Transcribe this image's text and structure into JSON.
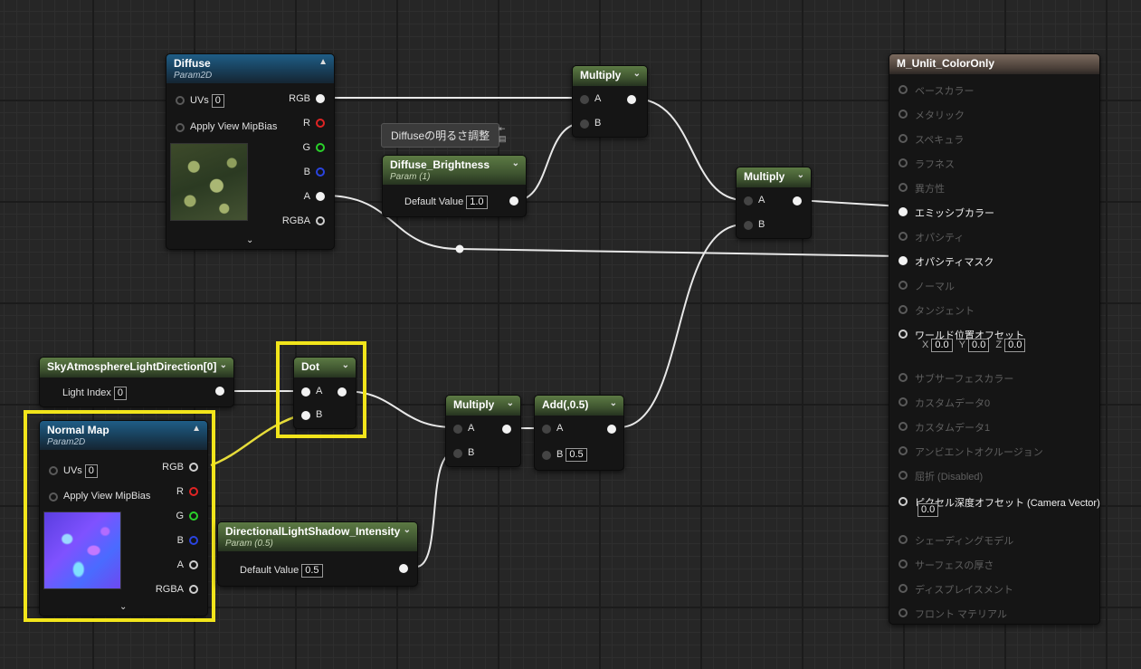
{
  "diffuse": {
    "title": "Diffuse",
    "subtitle": "Param2D",
    "uvs_label": "UVs",
    "uvs_value": "0",
    "mipbias_label": "Apply View MipBias",
    "outputs": [
      "RGB",
      "R",
      "G",
      "B",
      "A",
      "RGBA"
    ]
  },
  "comment": {
    "text": "Diffuseの明るさ調整"
  },
  "brightness": {
    "title": "Diffuse_Brightness",
    "subtitle": "Param (1)",
    "default_label": "Default Value",
    "default_value": "1.0"
  },
  "multiply_top": {
    "title": "Multiply",
    "in_a": "A",
    "in_b": "B"
  },
  "multiply_mid": {
    "title": "Multiply",
    "in_a": "A",
    "in_b": "B"
  },
  "sky": {
    "title": "SkyAtmosphereLightDirection[0]",
    "index_label": "Light Index",
    "index_value": "0"
  },
  "dot": {
    "title": "Dot",
    "in_a": "A",
    "in_b": "B"
  },
  "normal_map": {
    "title": "Normal Map",
    "subtitle": "Param2D",
    "uvs_label": "UVs",
    "uvs_value": "0",
    "mipbias_label": "Apply View MipBias",
    "outputs": [
      "RGB",
      "R",
      "G",
      "B",
      "A",
      "RGBA"
    ]
  },
  "multiply_low": {
    "title": "Multiply",
    "in_a": "A",
    "in_b": "B"
  },
  "add": {
    "title": "Add(,0.5)",
    "in_a": "A",
    "in_b": "B",
    "b_value": "0.5"
  },
  "shadow": {
    "title": "DirectionalLightShadow_Intensity",
    "subtitle": "Param (0.5)",
    "default_label": "Default Value",
    "default_value": "0.5"
  },
  "material": {
    "title": "M_Unlit_ColorOnly",
    "inputs": [
      "ベースカラー",
      "メタリック",
      "スペキュラ",
      "ラフネス",
      "異方性",
      "エミッシブカラー",
      "オパシティ",
      "オパシティマスク",
      "ノーマル",
      "タンジェント",
      "ワールド位置オフセット",
      "サブサーフェスカラー",
      "カスタムデータ0",
      "カスタムデータ1",
      "アンビエントオクルージョン",
      "屈折 (Disabled)",
      "ピクセル深度オフセット (Camera Vector)",
      "シェーディングモデル",
      "サーフェスの厚さ",
      "ディスプレイスメント",
      "フロント マテリアル"
    ],
    "wpo_x_label": "X",
    "wpo_x": "0.0",
    "wpo_y_label": "Y",
    "wpo_y": "0.0",
    "wpo_z_label": "Z",
    "wpo_z": "0.0",
    "pdo_value": "0.0"
  }
}
